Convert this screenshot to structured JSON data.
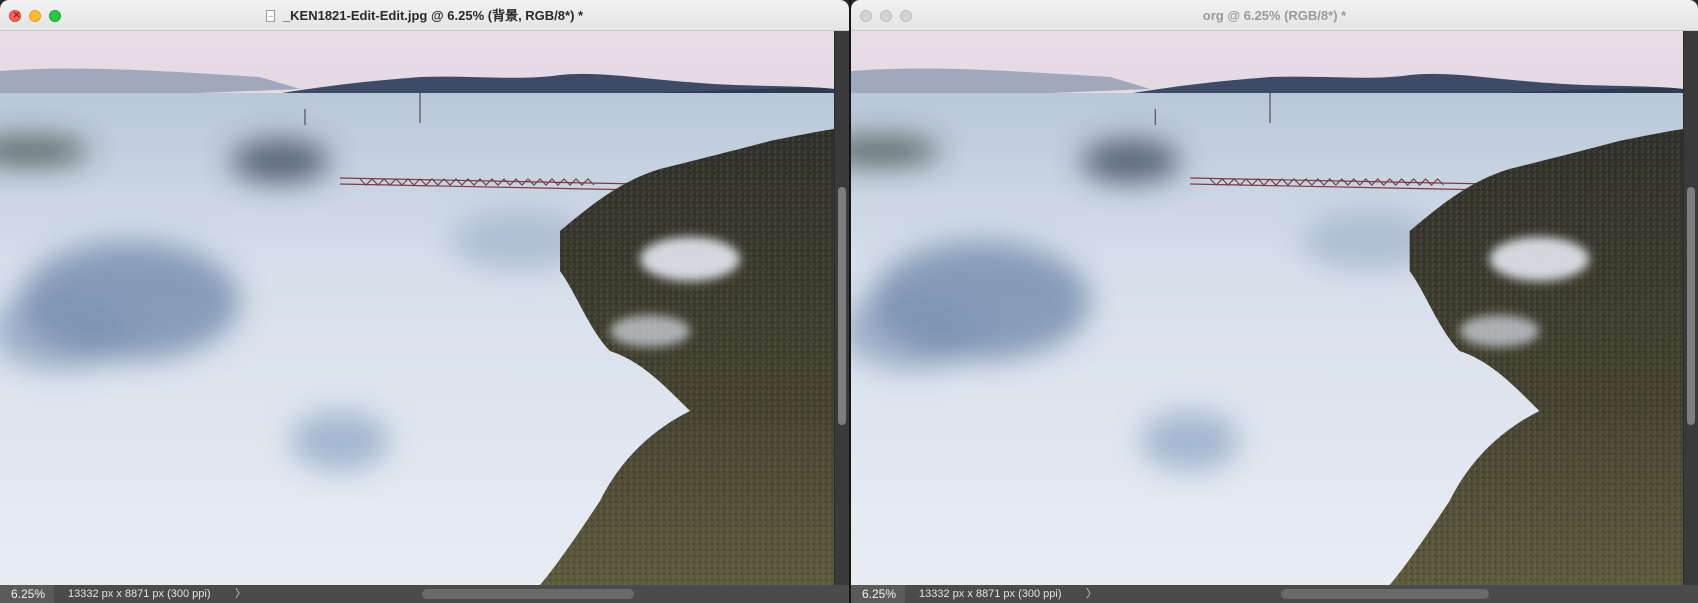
{
  "windows": [
    {
      "title": "_KEN1821-Edit-Edit.jpg @ 6.25% (背景, RGB/8*) *",
      "active": true,
      "status": {
        "zoom": "6.25%",
        "dimensions": "13332 px x 8871 px (300 ppi)",
        "chevron": "〉"
      }
    },
    {
      "title": "org @ 6.25% (RGB/8*) *",
      "active": false,
      "status": {
        "zoom": "6.25%",
        "dimensions": "13332 px x 8871 px (300 ppi)",
        "chevron": "〉"
      }
    }
  ],
  "icons": [
    "close-icon",
    "minimize-icon",
    "maximize-icon",
    "document-icon",
    "chevron-right-icon"
  ],
  "colors": {
    "sky_top": "#eadde6",
    "sky_bottom": "#bcc7d4",
    "mountain": "#3a4a66",
    "fog": "#dbe2ee",
    "fog_shadow": "#5f7898",
    "cliff": "#3c3b2c",
    "cliff_light": "#6b6a48",
    "bridge": "#7a3a3a"
  }
}
